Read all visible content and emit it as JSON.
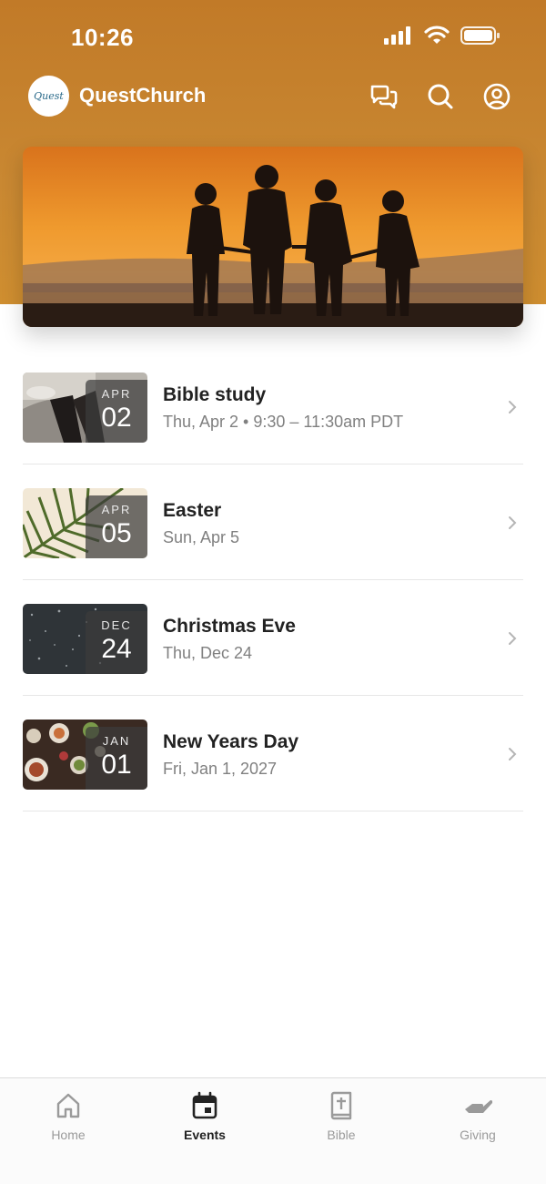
{
  "status": {
    "time": "10:26"
  },
  "app": {
    "name": "QuestChurch",
    "logo_text": "Quest"
  },
  "icons": {
    "messages": "chat-bubbles-icon",
    "search": "search-icon",
    "profile": "account-circle-icon"
  },
  "events": [
    {
      "month": "APR",
      "day": "02",
      "title": "Bible study",
      "subtitle": "Thu, Apr 2 • 9:30 – 11:30am PDT"
    },
    {
      "month": "APR",
      "day": "05",
      "title": "Easter",
      "subtitle": "Sun, Apr 5"
    },
    {
      "month": "DEC",
      "day": "24",
      "title": "Christmas Eve",
      "subtitle": "Thu, Dec 24"
    },
    {
      "month": "JAN",
      "day": "01",
      "title": "New Years Day",
      "subtitle": "Fri, Jan 1, 2027"
    }
  ],
  "tabs": [
    {
      "label": "Home",
      "icon": "home-icon",
      "active": false
    },
    {
      "label": "Events",
      "icon": "calendar-icon",
      "active": true
    },
    {
      "label": "Bible",
      "icon": "bible-icon",
      "active": false
    },
    {
      "label": "Giving",
      "icon": "giving-hand-icon",
      "active": false
    }
  ],
  "colors": {
    "accent": "#c98832",
    "text": "#222222",
    "muted": "#808080"
  }
}
